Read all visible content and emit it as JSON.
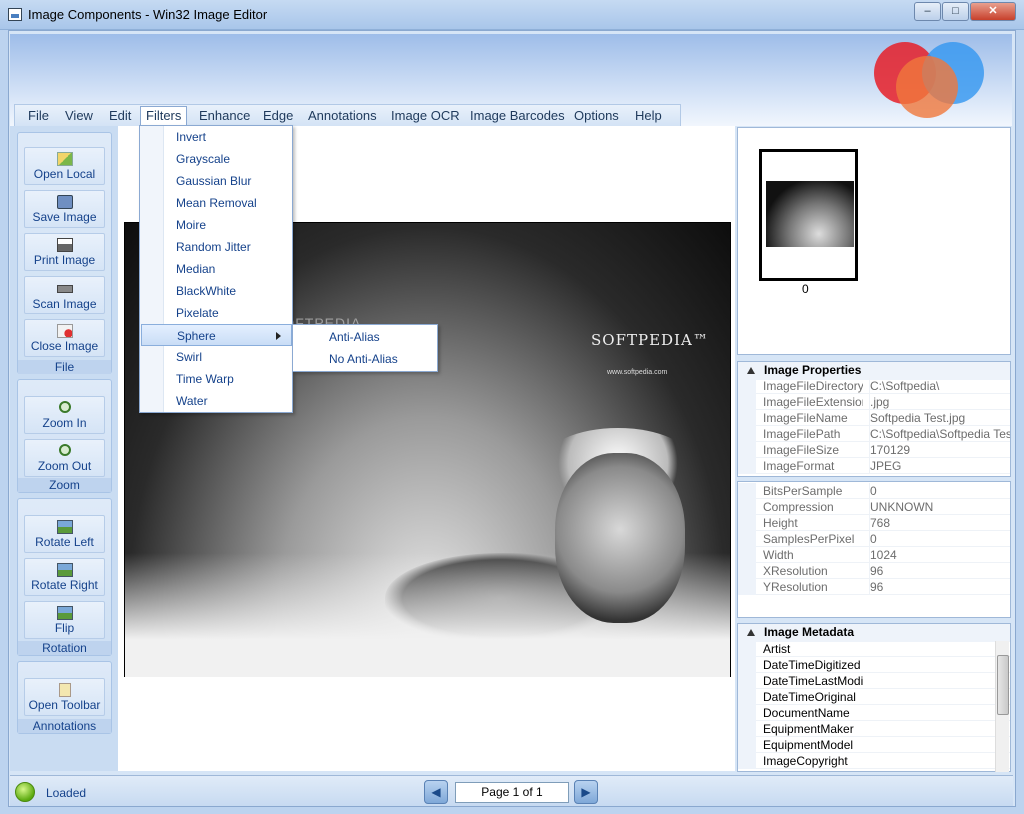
{
  "window": {
    "title": "Image Components - Win32 Image Editor",
    "controls": {
      "minimize": "–",
      "maximize": "□",
      "close": "✕"
    }
  },
  "menubar": [
    "File",
    "View",
    "Edit",
    "Filters",
    "Enhance",
    "Edge",
    "Annotations",
    "Image OCR",
    "Image Barcodes",
    "Options",
    "Help"
  ],
  "filters_menu": {
    "items": [
      "Invert",
      "Grayscale",
      "Gaussian Blur",
      "Mean Removal",
      "Moire",
      "Random Jitter",
      "Median",
      "BlackWhite",
      "Pixelate",
      "Sphere",
      "Swirl",
      "Time Warp",
      "Water"
    ],
    "highlighted": "Sphere",
    "sphere_submenu": [
      "Anti-Alias",
      "No Anti-Alias"
    ]
  },
  "toolbar_groups": {
    "file": {
      "label": "File",
      "buttons": [
        "Open Local",
        "Save Image",
        "Print Image",
        "Scan Image",
        "Close Image"
      ]
    },
    "zoom": {
      "label": "Zoom",
      "buttons": [
        "Zoom In",
        "Zoom Out"
      ]
    },
    "rotation": {
      "label": "Rotation",
      "buttons": [
        "Rotate Left",
        "Rotate Right",
        "Flip"
      ]
    },
    "annotations": {
      "label": "Annotations",
      "buttons": [
        "Open Toolbar"
      ]
    }
  },
  "image": {
    "logo_text": "SOFTPEDIA™",
    "url_text": "www.softpedia.com",
    "watermark": "SOFTPEDIA"
  },
  "thumbnail": {
    "label": "0"
  },
  "image_properties": {
    "header": "Image Properties",
    "rows": [
      {
        "key": "ImageFileDirectory",
        "value": "C:\\Softpedia\\"
      },
      {
        "key": "ImageFileExtension",
        "value": ".jpg"
      },
      {
        "key": "ImageFileName",
        "value": "Softpedia Test.jpg"
      },
      {
        "key": "ImageFilePath",
        "value": "C:\\Softpedia\\Softpedia Test.jpg"
      },
      {
        "key": "ImageFileSize",
        "value": "170129"
      },
      {
        "key": "ImageFormat",
        "value": "JPEG"
      }
    ]
  },
  "image_details": {
    "rows": [
      {
        "key": "BitsPerSample",
        "value": "0"
      },
      {
        "key": "Compression",
        "value": "UNKNOWN"
      },
      {
        "key": "Height",
        "value": "768"
      },
      {
        "key": "SamplesPerPixel",
        "value": "0"
      },
      {
        "key": "Width",
        "value": "1024"
      },
      {
        "key": "XResolution",
        "value": "96"
      },
      {
        "key": "YResolution",
        "value": "96"
      }
    ]
  },
  "image_metadata": {
    "header": "Image Metadata",
    "rows": [
      "Artist",
      "DateTimeDigitized",
      "DateTimeLastModified",
      "DateTimeOriginal",
      "DocumentName",
      "EquipmentMaker",
      "EquipmentModel",
      "ImageCopyright"
    ]
  },
  "statusbar": {
    "status": "Loaded",
    "page_text": "Page 1 of 1",
    "prev": "◀",
    "next": "▶"
  }
}
